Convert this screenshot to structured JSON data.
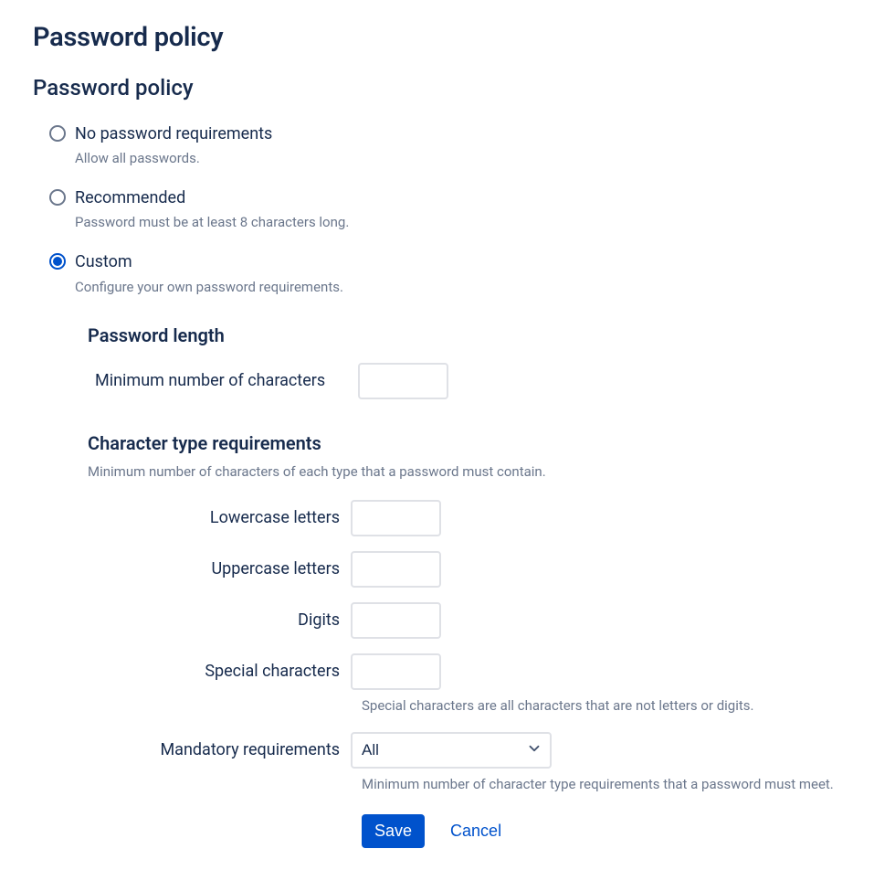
{
  "page": {
    "title": "Password policy",
    "section_title": "Password policy"
  },
  "radio": {
    "options": [
      {
        "label": "No password requirements",
        "description": "Allow all passwords."
      },
      {
        "label": "Recommended",
        "description": "Password must be at least 8 characters long."
      },
      {
        "label": "Custom",
        "description": "Configure your own password requirements."
      }
    ]
  },
  "custom": {
    "length_title": "Password length",
    "min_chars_label": "Minimum number of characters",
    "min_chars_value": "",
    "type_req_title": "Character type requirements",
    "type_req_description": "Minimum number of characters of each type that a password must contain.",
    "fields": {
      "lowercase_label": "Lowercase letters",
      "lowercase_value": "",
      "uppercase_label": "Uppercase letters",
      "uppercase_value": "",
      "digits_label": "Digits",
      "digits_value": "",
      "special_label": "Special characters",
      "special_value": "",
      "special_help": "Special characters are all characters that are not letters or digits."
    },
    "mandatory_label": "Mandatory requirements",
    "mandatory_value": "All",
    "mandatory_help": "Minimum number of character type requirements that a password must meet."
  },
  "buttons": {
    "save": "Save",
    "cancel": "Cancel"
  }
}
